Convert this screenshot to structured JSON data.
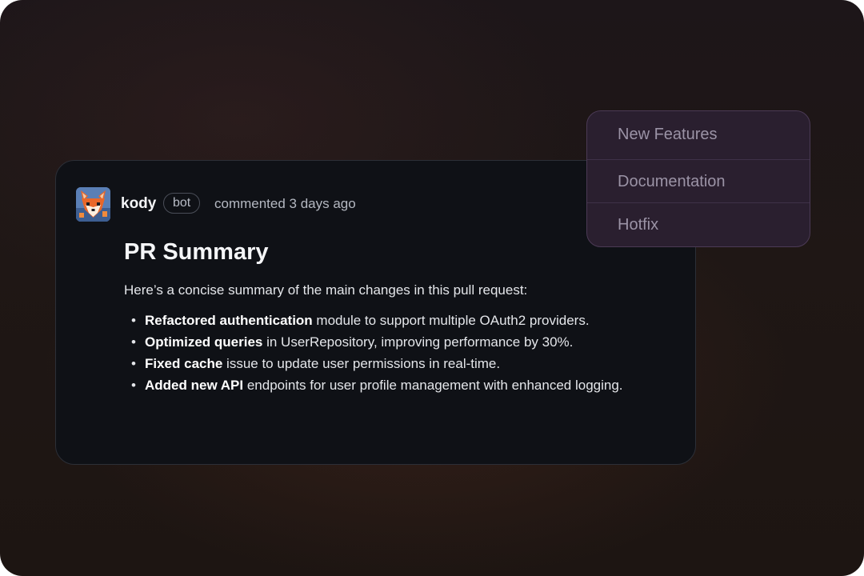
{
  "comment": {
    "author": "kody",
    "badge": "bot",
    "meta": "commented 3 days ago",
    "avatar_icon": "fox-avatar-icon",
    "title": "PR Summary",
    "intro": "Here’s a concise summary of the main changes in this pull request:",
    "changes": [
      {
        "bold": "Refactored authentication",
        "rest": " module to support multiple OAuth2 providers."
      },
      {
        "bold": "Optimized queries",
        "rest": " in UserRepository, improving performance by 30%."
      },
      {
        "bold": "Fixed cache",
        "rest": " issue to update user permissions in real-time."
      },
      {
        "bold": "Added new API",
        "rest": " endpoints for user profile management with enhanced logging."
      }
    ]
  },
  "menu": {
    "items": [
      {
        "label": "New Features"
      },
      {
        "label": "Documentation"
      },
      {
        "label": "Hotfix"
      }
    ]
  },
  "colors": {
    "card_bg": "#0f1116",
    "menu_bg": "#2a1f2f",
    "menu_text": "#9b93a6",
    "fox_orange": "#e8672a"
  }
}
